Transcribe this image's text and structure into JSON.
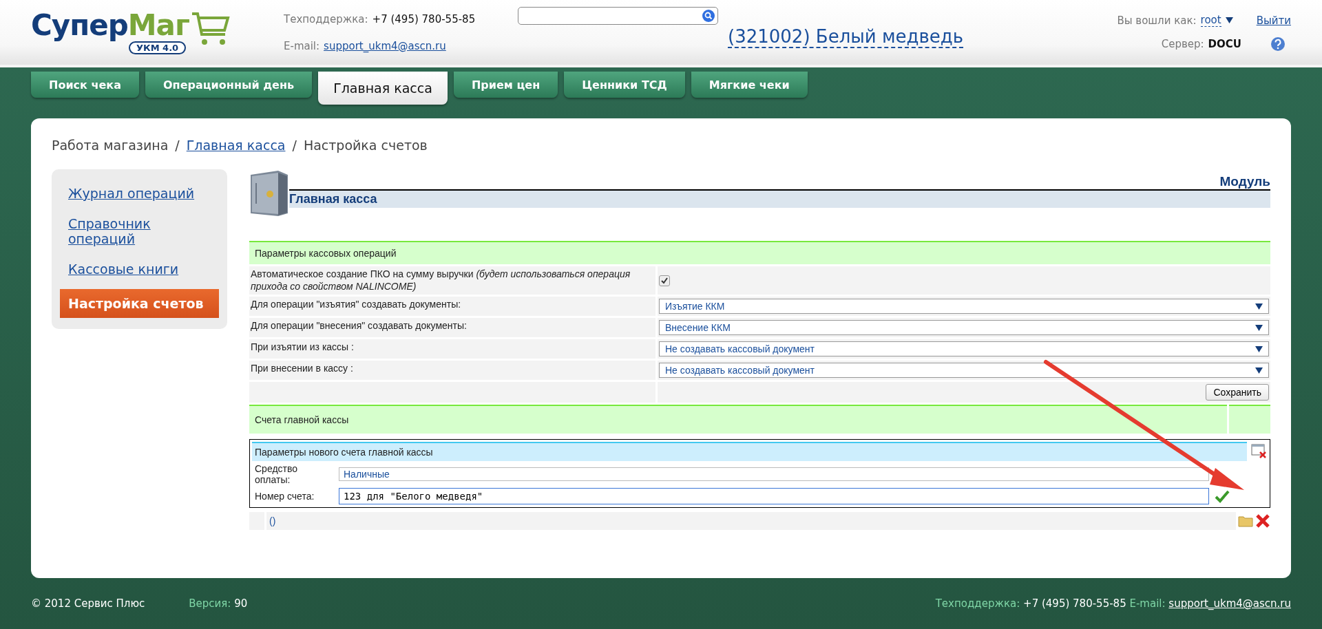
{
  "header": {
    "logo": {
      "parts": [
        "Супер",
        "Маг"
      ],
      "badge": "УКМ 4.0"
    },
    "support": {
      "label": "Техподдержка:",
      "phone": "+7 (495) 780-55-85",
      "email_label": "E-mail:",
      "email": "support_ukm4@ascn.ru"
    },
    "store": "(321002) Белый медведь",
    "user": {
      "label": "Вы вошли как:",
      "name": "root",
      "logout": "Выйти",
      "server_label": "Сервер:",
      "server": "DOCU"
    }
  },
  "tabs": [
    {
      "label": "Поиск чека",
      "selected": false
    },
    {
      "label": "Операционный день",
      "selected": false
    },
    {
      "label": "Главная касса",
      "selected": true
    },
    {
      "label": "Прием цен",
      "selected": false
    },
    {
      "label": "Ценники ТСД",
      "selected": false
    },
    {
      "label": "Мягкие чеки",
      "selected": false
    }
  ],
  "breadcrumb": {
    "separator": "/",
    "items": [
      {
        "label": "Работа магазина",
        "link": false
      },
      {
        "label": "Главная касса",
        "link": true
      },
      {
        "label": "Настройка счетов",
        "link": false
      }
    ]
  },
  "sidebar": {
    "items": [
      {
        "label": "Журнал операций",
        "selected": false
      },
      {
        "label": "Справочник операций",
        "selected": false
      },
      {
        "label": "Кассовые книги",
        "selected": false
      },
      {
        "label": "Настройка счетов",
        "selected": true
      }
    ]
  },
  "module": {
    "caption": "Модуль",
    "title": "Главная касса"
  },
  "cash_params": {
    "title": "Параметры кассовых операций",
    "rows": [
      {
        "kind": "checkbox",
        "label": "Автоматическое создание ПКО на сумму выручки *(будет использоваться операция прихода со свойством NALINCOME)*",
        "checked": true
      },
      {
        "kind": "select",
        "label": "Для операции \"изъятия\" создавать документы:",
        "value": "Изъятие ККМ"
      },
      {
        "kind": "select",
        "label": "Для операции \"внесения\" создавать документы:",
        "value": "Внесение ККМ"
      },
      {
        "kind": "select",
        "label": "При изъятии из кассы :",
        "value": "Не создавать кассовый документ"
      },
      {
        "kind": "select",
        "label": "При внесении в кассу :",
        "value": "Не создавать кассовый документ"
      }
    ],
    "save_button": "Сохранить"
  },
  "accounts": {
    "title": "Счета главной кассы",
    "new_account": {
      "title": "Параметры нового счета главной кассы",
      "fields": [
        {
          "kind": "select",
          "label": "Средство оплаты:",
          "value": "Наличные"
        },
        {
          "kind": "input",
          "label": "Номер счета:",
          "value": "123 для \"Белого медведя\""
        }
      ]
    },
    "rows": [
      {
        "link": "()"
      }
    ]
  },
  "footer": {
    "copyright": "© 2012 Сервис Плюс",
    "version_label": "Версия:",
    "version": "90",
    "support_label": "Техподдержка:",
    "phone": "+7 (495) 780-55-85",
    "email_label": "E-mail:",
    "email": "support_ukm4@ascn.ru"
  }
}
